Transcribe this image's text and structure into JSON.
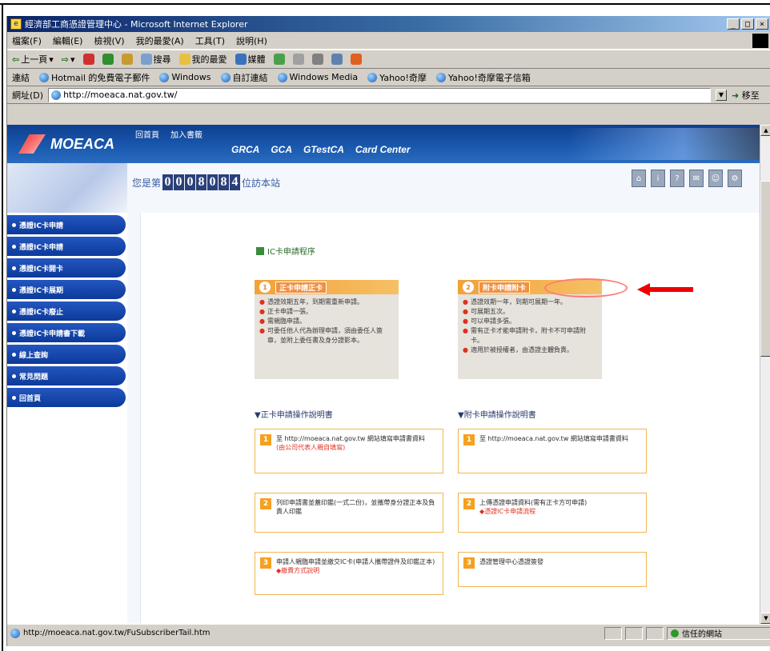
{
  "window": {
    "title": "經濟部工商憑證管理中心 - Microsoft Internet Explorer",
    "controls": [
      "_",
      "□",
      "×"
    ]
  },
  "menu": [
    "檔案(F)",
    "編輯(E)",
    "檢視(V)",
    "我的最愛(A)",
    "工具(T)",
    "說明(H)"
  ],
  "toolbar": {
    "back": "上一頁",
    "search": "搜尋",
    "favorites": "我的最愛",
    "media": "媒體"
  },
  "links": {
    "label": "連結",
    "items": [
      "Hotmail 的免費電子郵件",
      "Windows",
      "自訂連結",
      "Windows Media",
      "Yahoo!奇摩",
      "Yahoo!奇摩電子信箱"
    ]
  },
  "address": {
    "label": "網址(D)",
    "value": "http://moeaca.nat.gov.tw/",
    "go": "移至"
  },
  "banner": {
    "logo": "MOEACA",
    "top_links": [
      "回首頁",
      "加入書籤"
    ],
    "nav": [
      "GRCA",
      "GCA",
      "GTestCA",
      "Card Center"
    ]
  },
  "counter": {
    "prefix": "您是第",
    "digits": [
      "0",
      "0",
      "0",
      "8",
      "0",
      "8",
      "4"
    ],
    "suffix": "位訪本站"
  },
  "sidebar": {
    "items": [
      "憑證IC卡申請",
      "憑證IC卡申請",
      "憑證IC卡開卡",
      "憑證IC卡展期",
      "憑證IC卡廢止",
      "憑證IC卡申請書下載",
      "線上查詢",
      "常見問題",
      "回首頁"
    ]
  },
  "top_icons": [
    "⌂",
    "i",
    "?",
    "✉",
    "☺",
    "⚙"
  ],
  "main": {
    "procedure_title": "IC卡申請程序",
    "card_left": {
      "num": "1",
      "label": "正卡申請正卡",
      "lines": [
        "憑證效期五年，到期需重新申請。",
        "正卡申請一張。",
        "需親臨申請。",
        "可委任他人代為辦理申請，須由委任人簽章，並附上委任書及身分證影本。"
      ]
    },
    "card_right": {
      "num": "2",
      "label": "附卡申請附卡",
      "lines": [
        "憑證效期一年，到期可展期一年。",
        "可展期五次。",
        "可以申請多張。",
        "需有正卡才能申請附卡，附卡不可申請附卡。",
        "適用於被授權者，由憑證主體負責。"
      ]
    },
    "section_left": "▼正卡申請操作說明書",
    "section_right": "▼附卡申請操作說明書",
    "steps_left": [
      {
        "num": "1",
        "text": "至 http://moeaca.nat.gov.tw 網站填寫申請書資料",
        "red": "(由公司代表人親自填寫)"
      },
      {
        "num": "2",
        "text": "列印申請書並蓋印鑑(一式二份)，並攜帶身分證正本及負責人印鑑",
        "red": ""
      },
      {
        "num": "3",
        "text": "申請人親臨申請並繳交IC卡(申請人攜帶證件及印鑑正本)",
        "red": "◆繳費方式說明"
      }
    ],
    "steps_right": [
      {
        "num": "1",
        "text": "至 http://moeaca.nat.gov.tw 網站填寫申請書資料",
        "red": ""
      },
      {
        "num": "2",
        "text": "上傳憑證申請資料(需有正卡方可申請)",
        "red": "◆憑證IC卡申請流程"
      },
      {
        "num": "3",
        "text": "憑證管理中心憑證簽發",
        "red": ""
      }
    ]
  },
  "status": {
    "url": "http://moeaca.nat.gov.tw/FuSubscriberTail.htm",
    "zone": "信任的網站"
  },
  "colors": {
    "banner": "#1a5ab0",
    "sidebar_item": "#1446ae",
    "card_header": "#f2a23a",
    "arrow": "#ee0000"
  }
}
